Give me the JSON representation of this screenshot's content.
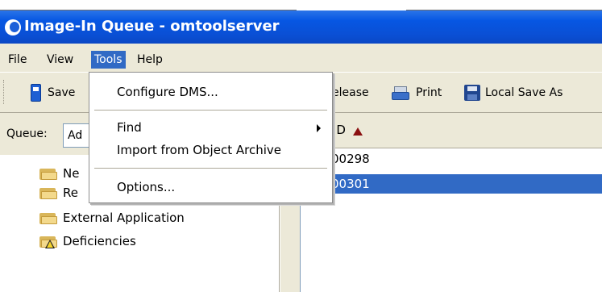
{
  "window": {
    "title": "Image-In Queue - omtoolserver"
  },
  "menubar": {
    "items": [
      "File",
      "View",
      "Tools",
      "Help"
    ],
    "active": "Tools"
  },
  "toolbar": {
    "save_label": "Save",
    "release_label": "elease",
    "print_label": "Print",
    "local_save_label": "Local Save As"
  },
  "queue": {
    "label": "Queue:",
    "selected_value": "Ad"
  },
  "tree": {
    "items": [
      "Ne",
      "Re",
      "External Application",
      "Deficiencies"
    ]
  },
  "list": {
    "column_header": "ID",
    "rows": [
      "00298",
      "00301"
    ],
    "selected_row": "00301"
  },
  "tools_menu": {
    "items": [
      "Configure DMS...",
      "Find",
      "Import from Object Archive",
      "Options..."
    ]
  },
  "colors": {
    "title_bar": "#0a4fd4",
    "selection": "#316ac5",
    "chrome": "#ece9d8",
    "sort_arrow": "#8a1010"
  }
}
